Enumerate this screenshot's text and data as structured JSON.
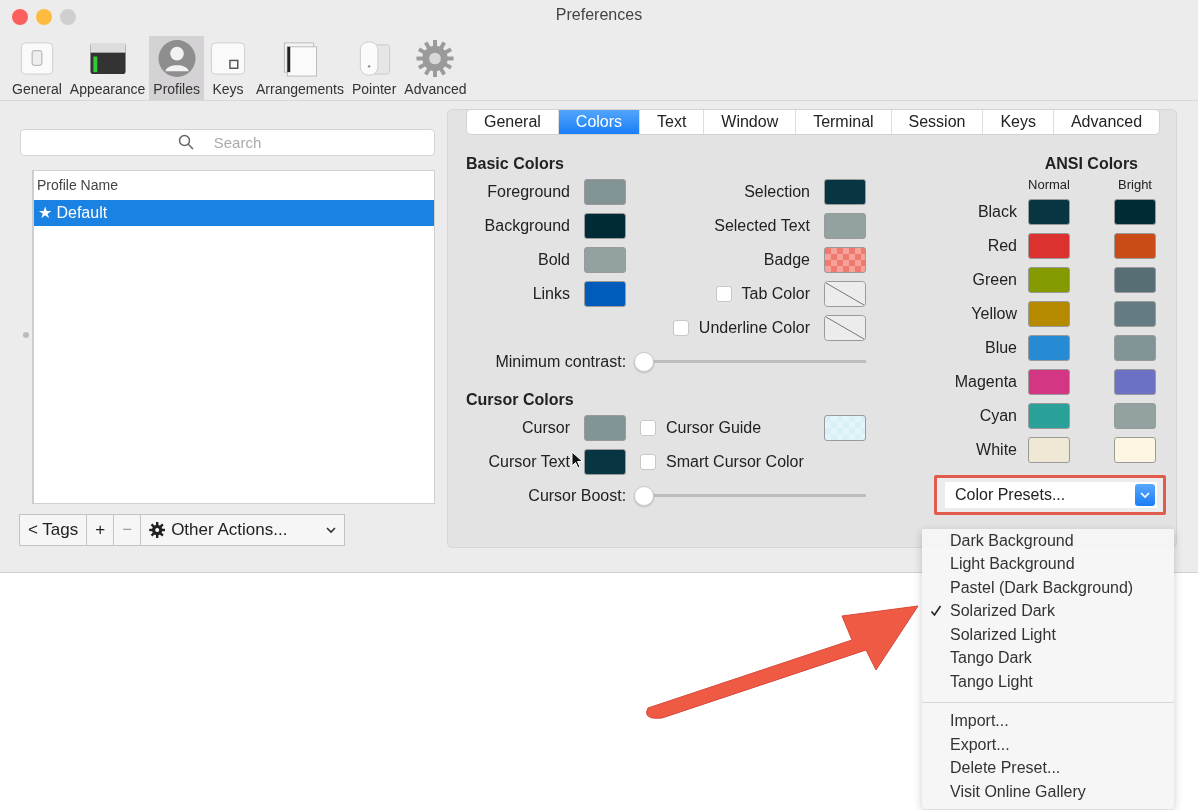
{
  "window": {
    "title": "Preferences"
  },
  "toolbar": [
    {
      "label": "General",
      "kind": "general",
      "selected": false
    },
    {
      "label": "Appearance",
      "kind": "appearance",
      "selected": false
    },
    {
      "label": "Profiles",
      "kind": "profiles",
      "selected": true
    },
    {
      "label": "Keys",
      "kind": "keys",
      "selected": false
    },
    {
      "label": "Arrangements",
      "kind": "arrangements",
      "selected": false
    },
    {
      "label": "Pointer",
      "kind": "pointer",
      "selected": false
    },
    {
      "label": "Advanced",
      "kind": "advanced",
      "selected": false
    }
  ],
  "profiles": {
    "search": {
      "placeholder": "Search"
    },
    "column": "Profile Name",
    "rows": [
      {
        "name": "★ Default",
        "selected": true
      }
    ],
    "buttons": [
      {
        "label": "< Tags",
        "kind": "text",
        "disabled": false
      },
      {
        "label": "+",
        "kind": "text",
        "disabled": false
      },
      {
        "label": "−",
        "kind": "text",
        "disabled": true
      },
      {
        "label": "Other Actions...",
        "kind": "menu",
        "disabled": false
      }
    ]
  },
  "tabs": [
    {
      "label": "General",
      "selected": false
    },
    {
      "label": "Colors",
      "selected": true
    },
    {
      "label": "Text",
      "selected": false
    },
    {
      "label": "Window",
      "selected": false
    },
    {
      "label": "Terminal",
      "selected": false
    },
    {
      "label": "Session",
      "selected": false
    },
    {
      "label": "Keys",
      "selected": false
    },
    {
      "label": "Advanced",
      "selected": false
    }
  ],
  "basic_colors": {
    "title": "Basic Colors",
    "left": [
      {
        "label": "Foreground",
        "kind": "color",
        "color": "#839496"
      },
      {
        "label": "Background",
        "kind": "color",
        "color": "#002b36"
      },
      {
        "label": "Bold",
        "kind": "color",
        "color": "#93a1a1"
      },
      {
        "label": "Links",
        "kind": "color",
        "color": "#005bbb"
      }
    ],
    "right": [
      {
        "label": "Selection",
        "kind": "color",
        "color": "#073642"
      },
      {
        "label": "Selected Text",
        "kind": "color",
        "color": "#93a1a1"
      },
      {
        "label": "Badge",
        "kind": "checker",
        "color": "#f07a70"
      },
      {
        "label": "Tab Color",
        "kind": "none",
        "checked": false
      },
      {
        "label": "Underline Color",
        "kind": "none",
        "checked": false
      }
    ],
    "slider": {
      "label": "Minimum contrast:",
      "level": 0
    }
  },
  "cursor_colors": {
    "title": "Cursor Colors",
    "left": [
      {
        "label": "Cursor",
        "kind": "color",
        "color": "#839496"
      },
      {
        "label": "Cursor Text",
        "kind": "color",
        "color": "#073642"
      }
    ],
    "right": [
      {
        "label": "Cursor Guide",
        "kind": "checker",
        "color": "#d8f0f6",
        "checked": false
      },
      {
        "label": "Smart Cursor Color",
        "kind": "blank",
        "checked": false
      }
    ],
    "slider": {
      "label": "Cursor Boost:",
      "level": 0
    }
  },
  "ansi_colors": {
    "title": "ANSI Colors",
    "normal_label": "Normal",
    "bright_label": "Bright",
    "rows": [
      {
        "label": "Black",
        "normal": {
          "color": "#073642"
        },
        "bright": {
          "color": "#002b36"
        }
      },
      {
        "label": "Red",
        "normal": {
          "color": "#dc322f"
        },
        "bright": {
          "color": "#cb4b16"
        }
      },
      {
        "label": "Green",
        "normal": {
          "color": "#859900"
        },
        "bright": {
          "color": "#586e75"
        }
      },
      {
        "label": "Yellow",
        "normal": {
          "color": "#b58900"
        },
        "bright": {
          "color": "#657b83"
        }
      },
      {
        "label": "Blue",
        "normal": {
          "color": "#268bd2"
        },
        "bright": {
          "color": "#839496"
        }
      },
      {
        "label": "Magenta",
        "normal": {
          "color": "#d33682"
        },
        "bright": {
          "color": "#6c71c4"
        }
      },
      {
        "label": "Cyan",
        "normal": {
          "color": "#2aa198"
        },
        "bright": {
          "color": "#93a1a1"
        }
      },
      {
        "label": "White",
        "normal": {
          "color": "#eee8d5"
        },
        "bright": {
          "color": "#fdf6e3"
        }
      }
    ]
  },
  "presets": {
    "label": "Color Presets...",
    "menu": [
      [
        {
          "label": "Dark Background",
          "checked": false
        },
        {
          "label": "Light Background",
          "checked": false
        },
        {
          "label": "Pastel (Dark Background)",
          "checked": false
        },
        {
          "label": "Solarized Dark",
          "checked": true
        },
        {
          "label": "Solarized Light",
          "checked": false
        },
        {
          "label": "Tango Dark",
          "checked": false
        },
        {
          "label": "Tango Light",
          "checked": false
        }
      ],
      [
        {
          "label": "Import...",
          "checked": false
        },
        {
          "label": "Export...",
          "checked": false
        },
        {
          "label": "Delete Preset...",
          "checked": false
        },
        {
          "label": "Visit Online Gallery",
          "checked": false
        }
      ]
    ]
  }
}
